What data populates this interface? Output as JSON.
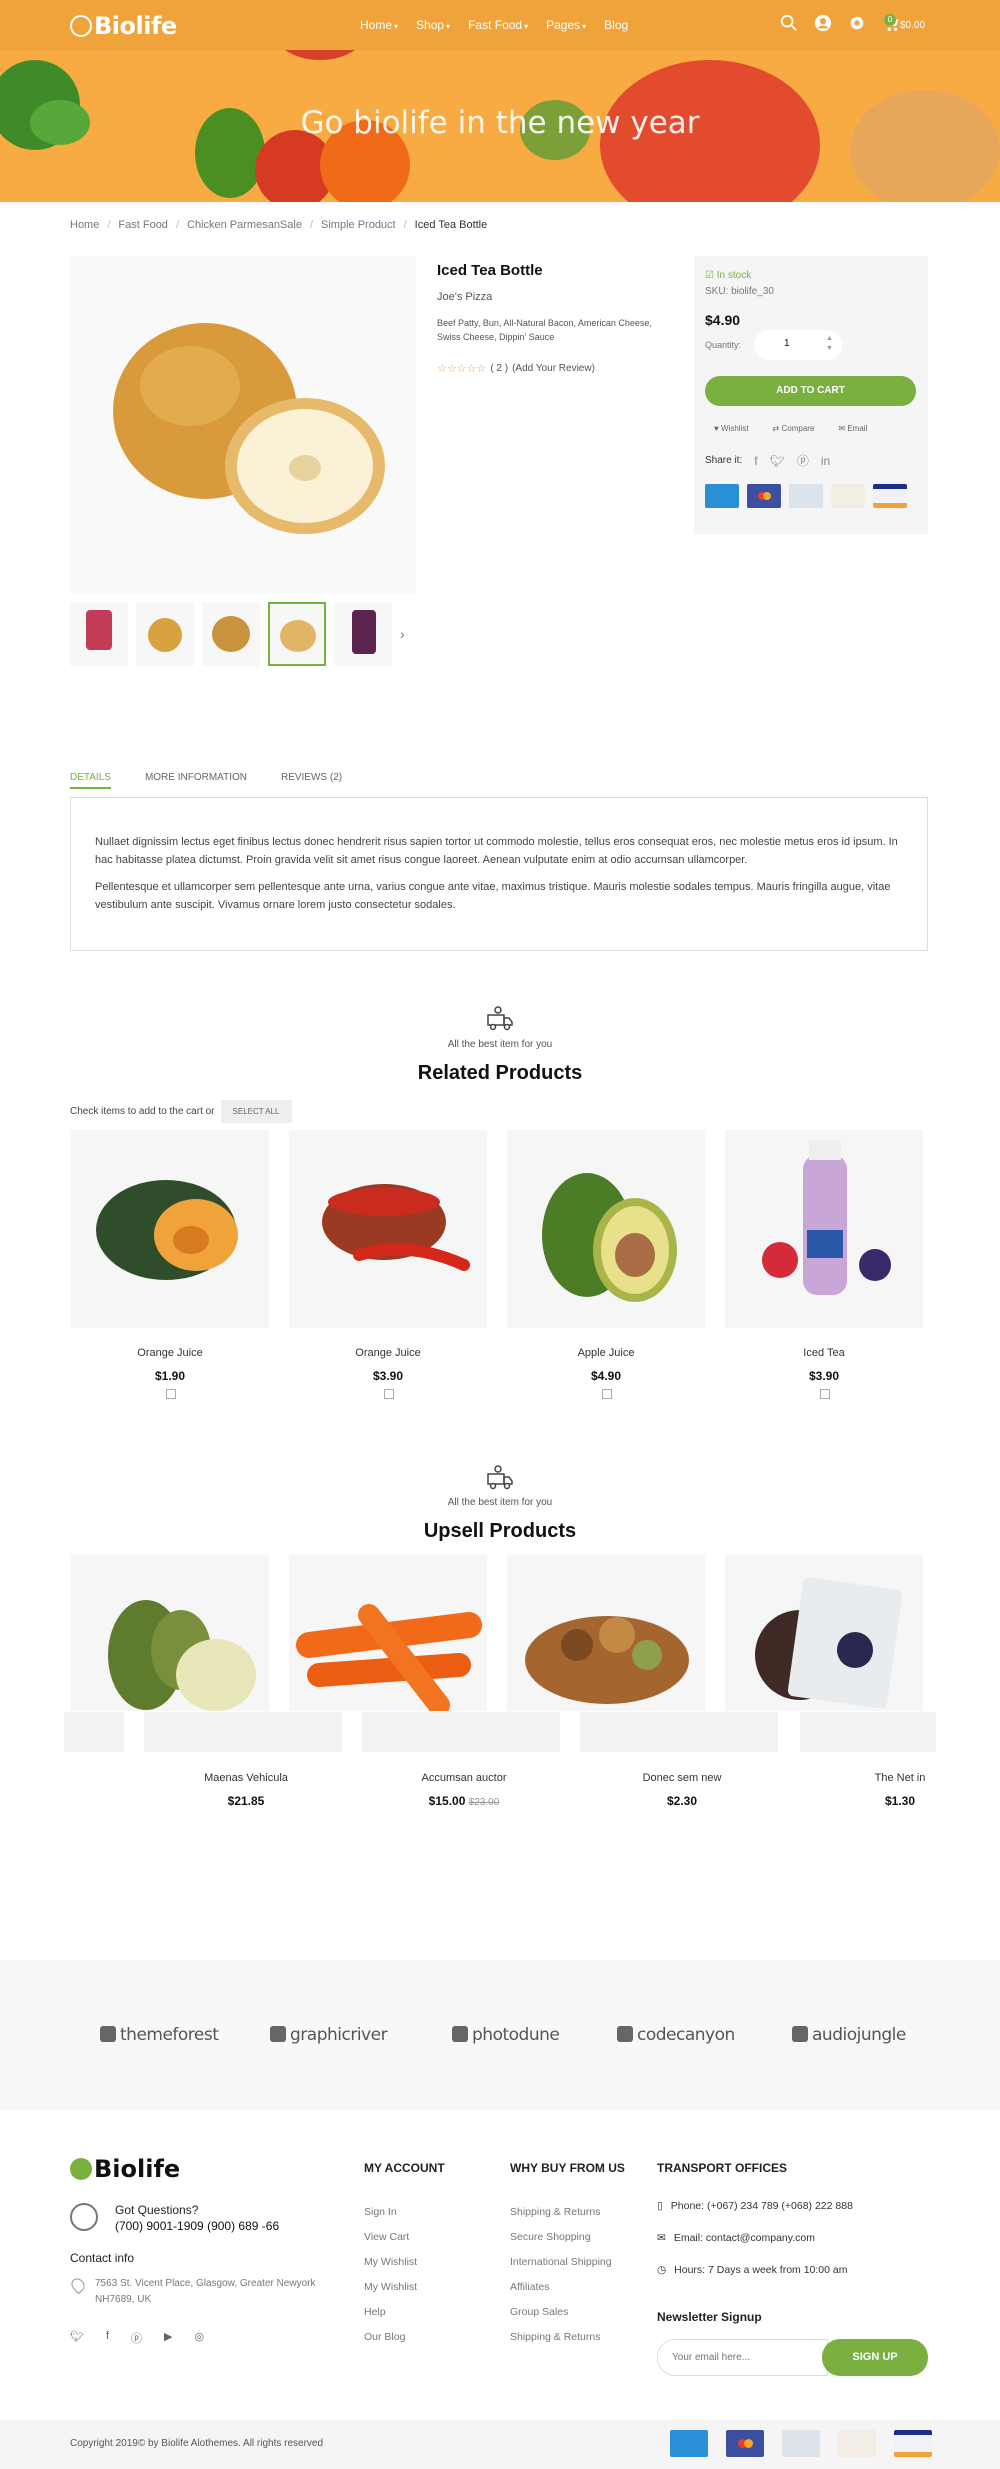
{
  "header": {
    "logo": "Biolife",
    "nav": [
      {
        "label": "Home",
        "has_caret": true
      },
      {
        "label": "Shop",
        "has_caret": true
      },
      {
        "label": "Fast Food",
        "has_caret": true
      },
      {
        "label": "Pages",
        "has_caret": true
      },
      {
        "label": "Blog",
        "has_caret": false
      }
    ],
    "cart_count": "0",
    "cart_total": "$0.00",
    "icons": [
      "search-icon",
      "user-icon",
      "gear-icon",
      "cart-icon"
    ]
  },
  "hero": {
    "title": "Go biolife in the new year"
  },
  "breadcrumb": [
    "Home",
    "Fast Food",
    "Chicken ParmesanSale",
    "Simple Product",
    "Iced Tea Bottle"
  ],
  "product": {
    "title": "Iced Tea Bottle",
    "brand": "Joe's Pizza",
    "description": "Beef Patty, Bun, All-Natural Bacon, American Cheese, Swiss Cheese, Dippin' Sauce",
    "rating_count": "( 2 )",
    "add_review": "(Add Your Review)",
    "rating_stars": 0,
    "thumbnails_count": 5,
    "active_thumbnail": 4
  },
  "buybox": {
    "stock": "In stock",
    "sku": "SKU: biolife_30",
    "price": "$4.90",
    "quantity_label": "Quantity:",
    "quantity_value": "1",
    "add_to_cart": "ADD TO CART",
    "wishlist": "Wishlist",
    "compare": "Compare",
    "email": "Email",
    "share_label": "Share it:",
    "share_icons": [
      "facebook-icon",
      "twitter-icon",
      "pinterest-icon",
      "linkedin-icon"
    ],
    "payments": [
      "AMERICAN EXPRESS",
      "MasterCard",
      "PayPal",
      "DISCOVER",
      "VISA"
    ]
  },
  "tabs": {
    "items": [
      "DETAILS",
      "MORE INFORMATION",
      "REVIEWS (2)"
    ],
    "active": 0,
    "paragraphs": [
      "Nullaet dignissim lectus eget finibus lectus donec hendrerit risus sapien tortor ut commodo molestie, tellus eros consequat eros, nec molestie metus eros id ipsum. In hac habitasse platea dictumst. Proin gravida velit sit amet risus congue laoreet. Aenean vulputate enim at odio accumsan ullamcorper.",
      "Pellentesque et ullamcorper sem pellentesque ante urna, varius congue ante vitae, maximus tristique. Mauris molestie sodales tempus. Mauris fringilla augue, vitae vestibulum ante suscipit. Vivamus ornare lorem justo consectetur sodales."
    ]
  },
  "related": {
    "subtitle": "All the best item for you",
    "title": "Related Products",
    "check_text": "Check items to add to the cart or",
    "select_all": "SELECT ALL",
    "items": [
      {
        "name": "Orange Juice",
        "price": "$1.90",
        "img": "pumpkin"
      },
      {
        "name": "Orange Juice",
        "price": "$3.90",
        "img": "chili"
      },
      {
        "name": "Apple Juice",
        "price": "$4.90",
        "img": "avocado"
      },
      {
        "name": "Iced Tea",
        "price": "$3.90",
        "img": "bottle"
      }
    ]
  },
  "upsell": {
    "subtitle": "All the best item for you",
    "title": "Upsell Products",
    "items": [
      {
        "name": "Maenas Vehicula",
        "price": "$21.85",
        "old_price": "",
        "img": "pear"
      },
      {
        "name": "Accumsan auctor",
        "price": "$15.00",
        "old_price": "$23.00",
        "img": "carrot"
      },
      {
        "name": "Donec sem new",
        "price": "$2.30",
        "old_price": "",
        "img": "nuts"
      },
      {
        "name": "The Net in",
        "price": "$1.30",
        "old_price": "",
        "img": "berries"
      }
    ]
  },
  "brands": [
    "themeforest",
    "graphicriver",
    "photodune",
    "codecanyon",
    "audiojungle"
  ],
  "footer": {
    "logo": "Biolife",
    "got_questions": "Got Questions?",
    "phone": "(700)  9001-1909 (900) 689 -66",
    "contact_info": "Contact info",
    "address": "7563 St. Vicent Place, Glasgow, Greater Newyork NH7689, UK",
    "social": [
      "twitter-icon",
      "facebook-icon",
      "pinterest-icon",
      "youtube-icon",
      "instagram-icon"
    ],
    "my_account": {
      "title": "MY ACCOUNT",
      "links": [
        "Sign In",
        "View Cart",
        "My Wishlist",
        "My Wishlist",
        "Help",
        "Our Blog"
      ]
    },
    "why_buy": {
      "title": "WHY BUY FROM US",
      "links": [
        "Shipping & Returns",
        "Secure Shopping",
        "International Shipping",
        "Affiliates",
        "Group Sales",
        "Shipping & Returns"
      ]
    },
    "transport": {
      "title": "TRANSPORT OFFICES",
      "phone": "Phone: (+067) 234 789 (+068) 222 888",
      "email": "Email: contact@company.com",
      "hours": "Hours: 7 Days a week from 10:00 am"
    },
    "newsletter": {
      "title": "Newsletter Signup",
      "placeholder": "Your email here...",
      "button": "SIGN UP"
    },
    "copyright": "Copyright 2019© by Biolife Alothemes. All rights reserved",
    "payments": [
      "AMERICAN EXPRESS",
      "MasterCard",
      "PayPal",
      "DISCOVER",
      "VISA"
    ]
  },
  "colors": {
    "accent_green": "#7ab040",
    "header_orange": "#f0a33a",
    "hero_orange": "#f9ab43"
  }
}
